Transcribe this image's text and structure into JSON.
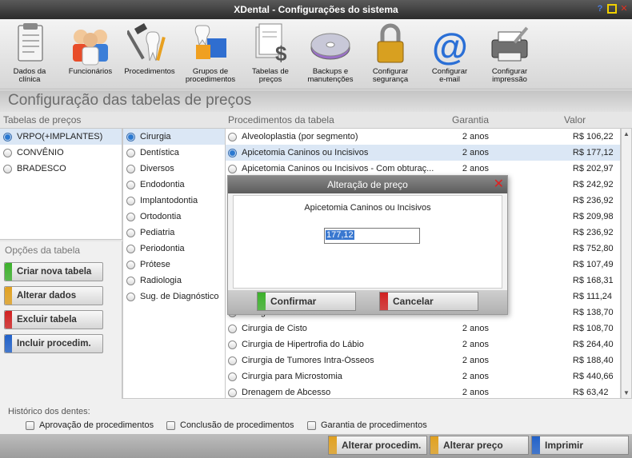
{
  "window": {
    "title": "XDental - Configurações do sistema",
    "help_label": "?",
    "close_label": "✕"
  },
  "toolbar": [
    {
      "label": "Dados da\nclínica",
      "icon": "clipboard-icon"
    },
    {
      "label": "Funcionários",
      "icon": "staff-icon"
    },
    {
      "label": "Procedimentos",
      "icon": "dental-tools-icon"
    },
    {
      "label": "Grupos de\nprocedimentos",
      "icon": "tooth-blocks-icon"
    },
    {
      "label": "Tabelas de\npreços",
      "icon": "price-list-icon"
    },
    {
      "label": "Backups e\nmanutenções",
      "icon": "disc-icon"
    },
    {
      "label": "Configurar\nsegurança",
      "icon": "padlock-icon"
    },
    {
      "label": "Configurar\ne-mail",
      "icon": "email-icon"
    },
    {
      "label": "Configurar\nimpressão",
      "icon": "printer-icon"
    }
  ],
  "section_title": "Configuração das tabelas de preços",
  "headers": {
    "tables": "Tabelas de preços",
    "procedures": "Procedimentos da tabela",
    "warranty": "Garantia",
    "value": "Valor"
  },
  "tables": [
    {
      "name": "VRPO(+IMPLANTES)",
      "selected": true
    },
    {
      "name": "CONVÊNIO",
      "selected": false
    },
    {
      "name": "BRADESCO",
      "selected": false
    }
  ],
  "options": {
    "title": "Opções da tabela",
    "buttons": [
      {
        "label": "Criar nova tabela",
        "color": "#3bb02a"
      },
      {
        "label": "Alterar dados",
        "color": "#e0a020"
      },
      {
        "label": "Excluir tabela",
        "color": "#d02020"
      },
      {
        "label": "Incluir procedim.",
        "color": "#2060c8"
      }
    ]
  },
  "specialties": [
    {
      "name": "Cirurgia",
      "selected": true
    },
    {
      "name": "Dentística"
    },
    {
      "name": "Diversos"
    },
    {
      "name": "Endodontia"
    },
    {
      "name": "Implantodontia"
    },
    {
      "name": "Ortodontia"
    },
    {
      "name": "Pediatria"
    },
    {
      "name": "Periodontia"
    },
    {
      "name": "Prótese"
    },
    {
      "name": "Radiologia"
    },
    {
      "name": "Sug. de Diagnóstico"
    }
  ],
  "procedures": [
    {
      "name": "Alveoloplastia (por segmento)",
      "warranty": "2 anos",
      "value": "R$ 106,22"
    },
    {
      "name": "Apicetomia Caninos ou Incisivos",
      "warranty": "2 anos",
      "value": "R$ 177,12",
      "selected": true
    },
    {
      "name": "Apicetomia Caninos ou Incisivos - Com obturaç...",
      "warranty": "2 anos",
      "value": "R$ 202,97"
    },
    {
      "name": "",
      "warranty": "",
      "value": "R$ 242,92"
    },
    {
      "name": "",
      "warranty": "",
      "value": "R$ 236,92"
    },
    {
      "name": "",
      "warranty": "",
      "value": "R$ 209,98"
    },
    {
      "name": "",
      "warranty": "",
      "value": "R$ 236,92"
    },
    {
      "name": "",
      "warranty": "",
      "value": "R$ 752,80"
    },
    {
      "name": "",
      "warranty": "",
      "value": "R$ 107,49"
    },
    {
      "name": "",
      "warranty": "",
      "value": "R$ 168,31"
    },
    {
      "name": "",
      "warranty": "",
      "value": "R$ 111,24"
    },
    {
      "name": "Cirurgia Para Torus Palatino",
      "warranty": "2 anos",
      "value": "R$ 138,70"
    },
    {
      "name": "Cirurgia de Cisto",
      "warranty": "2 anos",
      "value": "R$ 108,70"
    },
    {
      "name": "Cirurgia de Hipertrofia do Lábio",
      "warranty": "2 anos",
      "value": "R$ 264,40"
    },
    {
      "name": "Cirurgia de Tumores Intra-Ósseos",
      "warranty": "2 anos",
      "value": "R$ 188,40"
    },
    {
      "name": "Cirurgia para Microstomia",
      "warranty": "2 anos",
      "value": "R$ 440,66"
    },
    {
      "name": "Drenagem de Abcesso",
      "warranty": "2 anos",
      "value": "R$ 63,42"
    }
  ],
  "history": {
    "title": "Histórico dos dentes:",
    "options": [
      "Aprovação de procedimentos",
      "Conclusão de procedimentos",
      "Garantia de procedimentos"
    ]
  },
  "bottom_buttons": [
    {
      "label": "Alterar procedim.",
      "color": "#e0a020"
    },
    {
      "label": "Alterar preço",
      "color": "#e0a020"
    },
    {
      "label": "Imprimir",
      "color": "#2060c8"
    }
  ],
  "modal": {
    "title": "Alteração de preço",
    "procedure": "Apicetomia Caninos ou Incisivos",
    "value": "177,12",
    "confirm_label": "Confirmar",
    "confirm_color": "#3bb02a",
    "cancel_label": "Cancelar",
    "cancel_color": "#d02020"
  }
}
